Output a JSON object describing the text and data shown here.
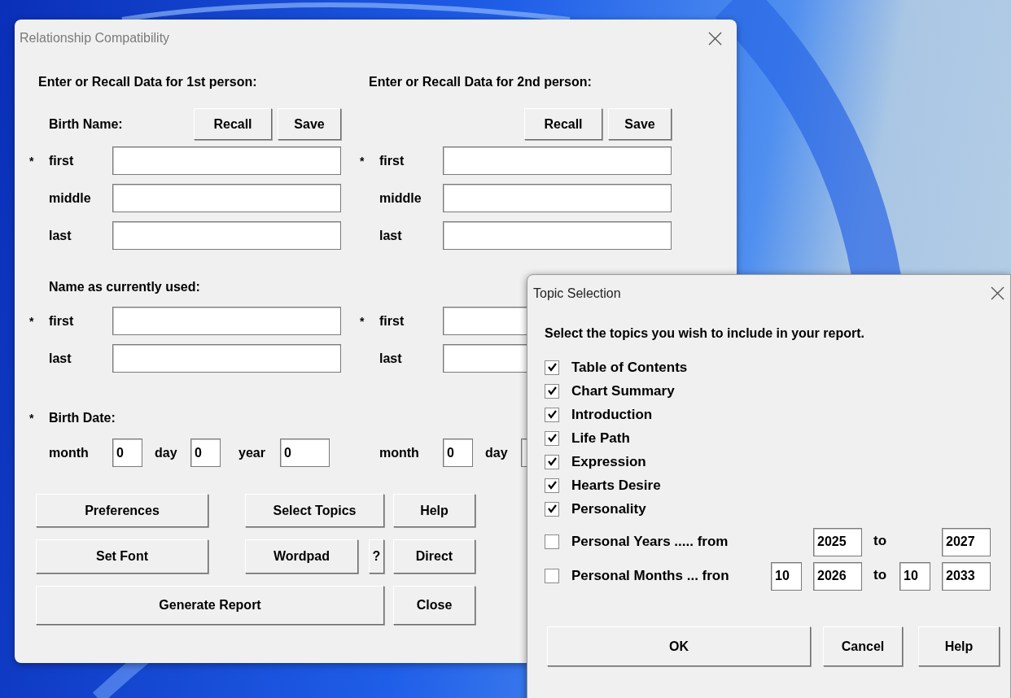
{
  "main_window": {
    "title": "Relationship Compatibility",
    "persons": [
      {
        "heading": "Enter or Recall Data for 1st person:",
        "birth_name_label": "Birth Name:",
        "buttons": [
          "Recall",
          "Save"
        ],
        "birth_name_fields": [
          {
            "marker": "*",
            "label": "first"
          },
          {
            "label": "middle"
          },
          {
            "label": "last"
          }
        ],
        "current_name_label": "Name as currently used:",
        "current_name_fields": [
          {
            "marker": "*",
            "label": "first"
          },
          {
            "label": "last"
          }
        ],
        "birth_date_marker": "*",
        "birth_date_label": "Birth Date:",
        "date_fields": [
          {
            "label": "month",
            "value": "0"
          },
          {
            "label": "day",
            "value": "0"
          },
          {
            "label": "year",
            "value": "0"
          }
        ]
      },
      {
        "heading": "Enter or Recall Data for 2nd person:",
        "buttons": [
          "Recall",
          "Save"
        ],
        "birth_name_fields": [
          {
            "marker": "*",
            "label": "first"
          },
          {
            "label": "middle"
          },
          {
            "label": "last"
          }
        ],
        "current_name_fields": [
          {
            "marker": "*",
            "label": "first"
          },
          {
            "label": "last"
          }
        ],
        "date_fields": [
          {
            "label": "month",
            "value": "0"
          },
          {
            "label": "day"
          }
        ]
      }
    ],
    "button_rows": [
      [
        "Preferences",
        "Select Topics",
        "Help"
      ],
      [
        "Set Font",
        "Wordpad",
        "?",
        "Direct"
      ],
      [
        "Generate Report",
        "Close"
      ]
    ]
  },
  "topic_dialog": {
    "title": "Topic Selection",
    "instruction": "Select the topics you wish to include in your report.",
    "topics": [
      {
        "label": "Table of Contents",
        "checked": true
      },
      {
        "label": "Chart Summary",
        "checked": true
      },
      {
        "label": "Introduction",
        "checked": true
      },
      {
        "label": "Life Path",
        "checked": true
      },
      {
        "label": "Expression",
        "checked": true
      },
      {
        "label": "Hearts Desire",
        "checked": true
      },
      {
        "label": "Personality",
        "checked": true
      }
    ],
    "ranges": [
      {
        "label": "Personal Years ..... from",
        "checked": false,
        "from": {
          "year": "2025"
        },
        "to_label": "to",
        "to": {
          "year": "2027"
        }
      },
      {
        "label": "Personal Months ... fron",
        "checked": false,
        "from": {
          "month": "10",
          "year": "2026"
        },
        "to_label": "to",
        "to": {
          "month": "10",
          "year": "2033"
        }
      }
    ],
    "buttons": [
      "OK",
      "Cancel",
      "Help"
    ]
  }
}
